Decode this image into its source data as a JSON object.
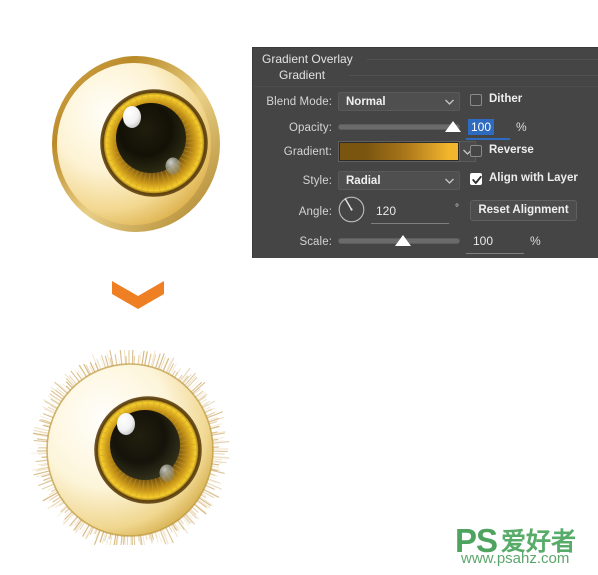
{
  "panel": {
    "title": "Gradient Overlay",
    "subtitle": "Gradient",
    "rows": {
      "blend_mode": {
        "label": "Blend Mode:",
        "value": "Normal",
        "dither": {
          "label": "Dither",
          "checked": false
        }
      },
      "opacity": {
        "label": "Opacity:",
        "value": "100",
        "unit": "%",
        "slider_percent": 100,
        "selected": true
      },
      "gradient": {
        "label": "Gradient:",
        "swatch_from": "#7a5510",
        "swatch_mid": "#a9761a",
        "swatch_to": "#f2b52c",
        "reverse": {
          "label": "Reverse",
          "checked": false
        }
      },
      "style": {
        "label": "Style:",
        "value": "Radial",
        "align_with_layer": {
          "label": "Align with Layer",
          "checked": true
        }
      },
      "angle": {
        "label": "Angle:",
        "value": "120",
        "unit": "°",
        "reset_button": "Reset Alignment"
      },
      "scale": {
        "label": "Scale:",
        "value": "100",
        "unit": "%",
        "slider_percent": 55
      }
    }
  },
  "illustrations": {
    "eye_top": {
      "name": "golden eyeball before fur",
      "sclera_light": "#fdf6e0",
      "sclera_gold": "#efc95c",
      "rim_brown": "#b4862b",
      "iris_outer": "#7c5410",
      "iris_gold": "#f5c62b",
      "pupil": "#141206",
      "highlight": "#ffffff"
    },
    "eye_bottom": {
      "name": "golden eyeball with fur edge",
      "fur_color": "#d9b574"
    },
    "arrow": {
      "name": "chevron-down",
      "color": "#ee7f22"
    }
  },
  "watermark": {
    "brand": "PS",
    "brand_cn": "爱好者",
    "url": "www.psahz.com",
    "color": "#3f9c52"
  }
}
